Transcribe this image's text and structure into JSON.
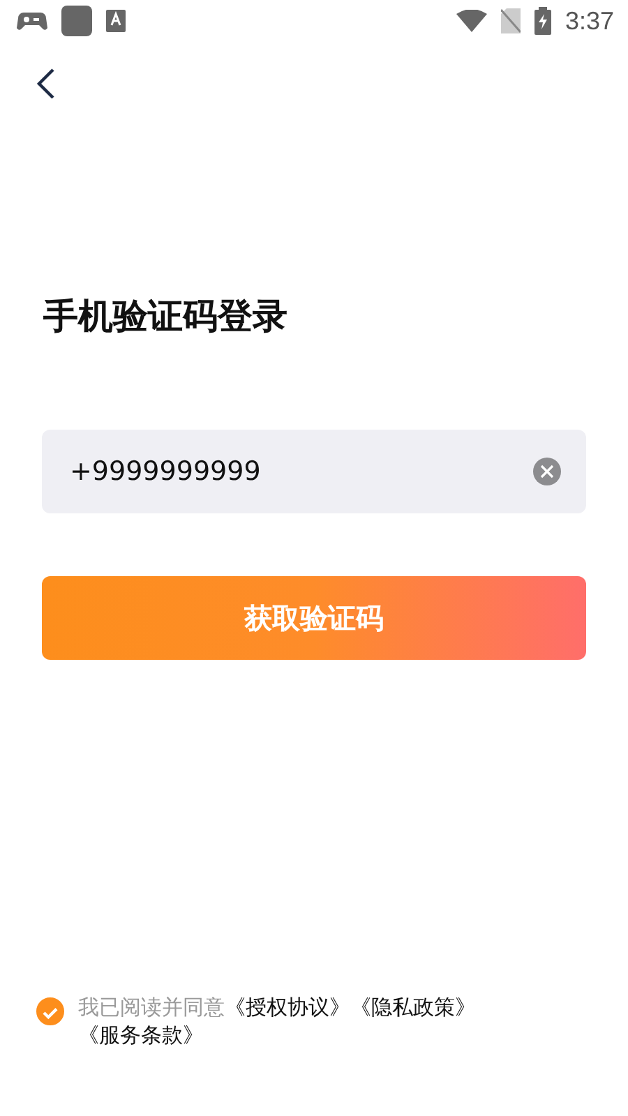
{
  "status_bar": {
    "time": "3:37"
  },
  "title": "手机验证码登录",
  "phone_field": {
    "value": "+9999999999"
  },
  "submit_button": {
    "label": "获取验证码"
  },
  "agreement": {
    "checked": true,
    "prefix": "我已阅读并同意",
    "links": [
      "《授权协议》",
      "《隐私政策》",
      "《服务条款》"
    ]
  }
}
